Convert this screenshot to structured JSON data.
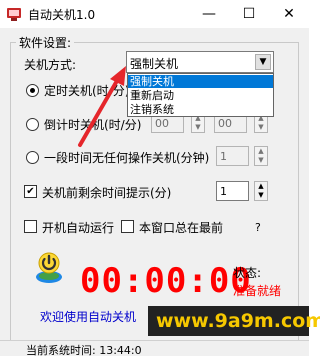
{
  "window": {
    "title": "自动关机1.0",
    "minimize_symbol": "—",
    "maximize_symbol": "☐",
    "close_symbol": "✕"
  },
  "settings": {
    "group_label": "软件设置:",
    "shutdown_method_label": "关机方式:",
    "shutdown_method_value": "强制关机",
    "dropdown_options": [
      "强制关机",
      "重新启动",
      "注销系统"
    ],
    "timed_shutdown_label": "定时关机(时/分)",
    "countdown_label": "倒计时关机(时/分)",
    "countdown_hours": "00",
    "countdown_minutes": "00",
    "idle_label": "一段时间无任何操作关机(分钟)",
    "idle_minutes": "1",
    "reminder_label": "关机前剩余时间提示(分)",
    "reminder_minutes": "1",
    "autostart_label": "开机自动运行",
    "topmost_label": "本窗口总在最前",
    "help_symbol": "?"
  },
  "timer": {
    "display": "00:00:00",
    "status_label": "状态:",
    "status_value": "准备就绪"
  },
  "welcome": "欢迎使用自动关机",
  "statusbar": {
    "text": "当前系统时间: 13:44:0"
  },
  "watermark": "www.9a9m.com",
  "colors": {
    "clock": "#ff0000",
    "status_value": "#ff0000",
    "welcome": "#0000cc",
    "selection": "#0078d7",
    "arrow": "#e5262b"
  }
}
